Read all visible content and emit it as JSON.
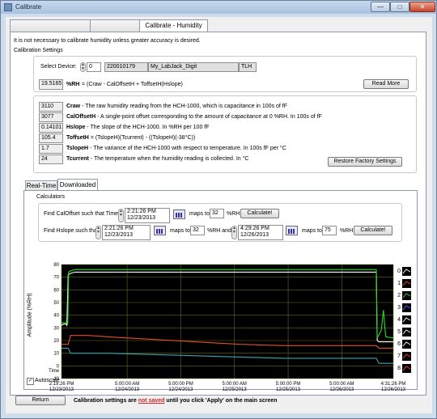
{
  "window": {
    "title": "Calibrate",
    "minimize_label": "—",
    "maximize_label": "□",
    "close_label": "✕"
  },
  "tabs": [
    {
      "label": ""
    },
    {
      "label": ""
    },
    {
      "label": "Calibrate - Humidity"
    }
  ],
  "intro_text": "It is not necessary to calibrate humidity unless greater accuracy is desired.",
  "settings_header": "Calibration Settings",
  "device": {
    "label": "Select Device:",
    "index": "0",
    "serial": "220010179",
    "name": "My_LabJack_Digit",
    "type": "TLH"
  },
  "formula": {
    "value": "19.5165",
    "unit": "%RH",
    "text": "= (Craw - CalOffsetH + ToffsetH(Hslope)"
  },
  "read_more_label": "Read More",
  "params": [
    {
      "value": "3110",
      "name": "Craw",
      "desc": " - The raw humidity reading from the HCH-1000, which is capacitance in 100s of fF"
    },
    {
      "value": "3077",
      "name": "CalOffsetH",
      "desc": " - A single-point offset corresponding to the amount of capacitance at 0 %RH.  In 100s of fF"
    },
    {
      "value": "0.14101",
      "name": "Hslope",
      "desc": " - The slope of the HCH-1000.  In %RH per 100 fF"
    },
    {
      "value": "105.4",
      "name": "ToffsetH",
      "desc": " = (TslopeH)(Tcurrent) - ((TslopeH)(-38°C))"
    },
    {
      "value": "1.7",
      "name": "TslopeH",
      "desc": " - The variance of the HCH-1000 with respect to temperature.  In 100s fF per °C"
    },
    {
      "value": "24",
      "name": "Tcurrent",
      "desc": " - The temperature when the humidity reading is collected.  In °C"
    }
  ],
  "restore_label": "Restore Factory Settings",
  "subtabs": [
    {
      "label": "Real-Time"
    },
    {
      "label": "Downloaded"
    }
  ],
  "calculators": {
    "header": "Calculators",
    "row1": {
      "label": "Find CalOffset such that Time",
      "time": "2:21:26 PM",
      "date": "12/23/2013",
      "maps_to": "maps to",
      "rh_value": "32",
      "unit": "%RH",
      "button": "Calculate!"
    },
    "row2": {
      "label": "Find Hslope such that",
      "time1": "2:21:26 PM",
      "date1": "12/23/2013",
      "maps_to1": "maps to",
      "rh1": "32",
      "and_text": "%RH and",
      "time2": "4:29:26 PM",
      "date2": "12/26/2013",
      "maps_to2": "maps to",
      "rh2": "75",
      "unit": "%RH",
      "button": "Calculate!"
    }
  },
  "chart_data": {
    "type": "line",
    "title": "",
    "xlabel": "Time",
    "ylabel": "Amplitude (%RH)",
    "ylim": [
      -10,
      80
    ],
    "y_ticks": [
      "80",
      "70",
      "60",
      "50",
      "40",
      "30",
      "20",
      "10",
      "0",
      "-10"
    ],
    "x_ticks": [
      {
        "time": "2:19:26 PM",
        "date": "12/23/2013"
      },
      {
        "time": "5:00:00 AM",
        "date": "12/24/2013"
      },
      {
        "time": "5:00:00 PM",
        "date": "12/24/2013"
      },
      {
        "time": "5:00:00 AM",
        "date": "12/25/2013"
      },
      {
        "time": "5:00:00 PM",
        "date": "12/25/2013"
      },
      {
        "time": "5:00:00 AM",
        "date": "12/26/2013"
      },
      {
        "time": "4:31:26 PM",
        "date": "12/26/2013"
      }
    ],
    "x_positions_hours": [
      0,
      14.68,
      26.68,
      38.68,
      50.68,
      62.68,
      74.2
    ],
    "xlim_hours": [
      0,
      74.2
    ],
    "grid": true,
    "legend_placement": "right",
    "legend": [
      "0",
      "1",
      "2",
      "3",
      "4",
      "5",
      "6",
      "7",
      "8"
    ],
    "series": [
      {
        "color": "#ffffff",
        "x": [
          0,
          0.5,
          1,
          1.2,
          1.5,
          2,
          3,
          6,
          10,
          20,
          30,
          40,
          50,
          60,
          68,
          70.4,
          70.6,
          71,
          73,
          74.2
        ],
        "y": [
          32,
          33,
          33,
          32,
          72,
          73,
          74,
          74,
          74,
          74,
          74,
          74,
          74,
          74,
          74,
          74,
          20,
          19,
          19,
          19
        ]
      },
      {
        "color": "#22dd22",
        "x": [
          0,
          1,
          1.4,
          1.6,
          2,
          3,
          6,
          10,
          20,
          30,
          40,
          50,
          60,
          68,
          70.4,
          70.6,
          71.5,
          72,
          72.5,
          74.2
        ],
        "y": [
          34,
          34,
          33,
          74,
          75,
          76,
          76,
          76,
          76,
          76,
          76,
          76,
          76,
          76,
          76,
          22,
          28,
          44,
          23,
          22
        ]
      },
      {
        "color": "#e0502a",
        "x": [
          0,
          1.5,
          2,
          6,
          10,
          20,
          30,
          40,
          50,
          60,
          68,
          70.4,
          71,
          74.2
        ],
        "y": [
          17,
          17,
          24,
          24,
          23,
          21,
          19,
          17,
          16,
          16,
          16,
          16,
          14,
          14
        ]
      },
      {
        "color": "#3aa6b0",
        "x": [
          0,
          1.5,
          2,
          6,
          10,
          20,
          30,
          40,
          50,
          60,
          68,
          70.4,
          71,
          74.2
        ],
        "y": [
          14,
          14,
          10,
          10,
          10,
          9,
          8,
          7,
          6,
          6,
          6,
          6,
          2,
          2
        ]
      }
    ]
  },
  "autoscale_label": "Autoscale",
  "footer": {
    "return_label": "Return",
    "msg1": "Calibration settings are ",
    "msg_red": "are not saved",
    "msg_red_display": "not saved",
    "msg2": " until you click 'Apply' on the main screen"
  }
}
